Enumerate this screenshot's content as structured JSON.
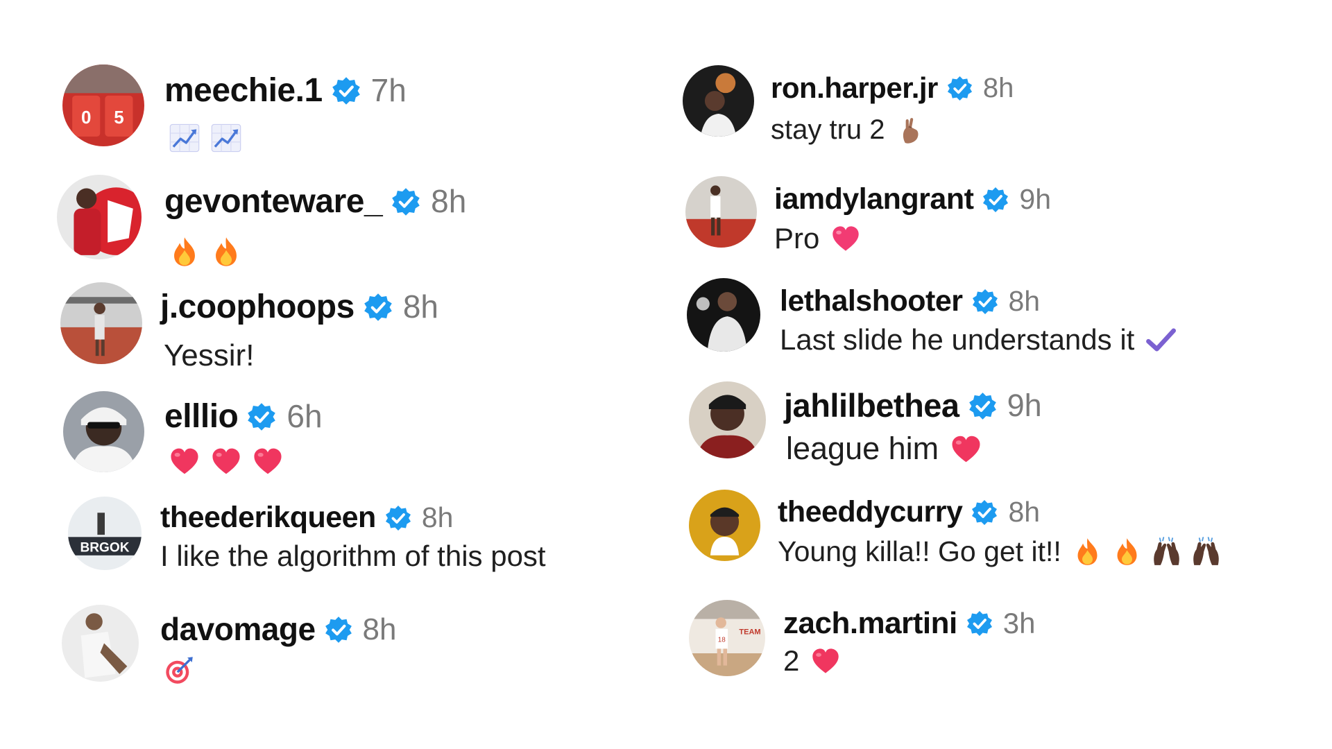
{
  "colors": {
    "verified": "#1d9bf0",
    "time": "#7a7a7a",
    "heart": "#f0365f",
    "fire": "#ff7b1c"
  },
  "comments": [
    {
      "username": "meechie.1",
      "time": "7h",
      "text": "",
      "emojis": [
        "chart-increasing",
        "chart-increasing"
      ]
    },
    {
      "username": "gevonteware_",
      "time": "8h",
      "text": "",
      "emojis": [
        "fire",
        "fire"
      ]
    },
    {
      "username": "j.coophoops",
      "time": "8h",
      "text": "Yessir!",
      "emojis": []
    },
    {
      "username": "elllio",
      "time": "6h",
      "text": "",
      "emojis": [
        "red-heart",
        "red-heart",
        "red-heart"
      ]
    },
    {
      "username": "theederikqueen",
      "time": "8h",
      "text": "I like the algorithm of this post",
      "emojis": []
    },
    {
      "username": "davomage",
      "time": "8h",
      "text": "",
      "emojis": [
        "bullseye"
      ]
    },
    {
      "username": "ron.harper.jr",
      "time": "8h",
      "text": "stay tru 2",
      "emojis": [
        "crossed-fingers"
      ]
    },
    {
      "username": "iamdylangrant",
      "time": "9h",
      "text": "Pro",
      "emojis": [
        "pink-heart"
      ]
    },
    {
      "username": "lethalshooter",
      "time": "8h",
      "text": "Last slide he understands it",
      "emojis": [
        "check-mark"
      ]
    },
    {
      "username": "jahlilbethea",
      "time": "9h",
      "text": "league him",
      "emojis": [
        "red-heart"
      ]
    },
    {
      "username": "theeddycurry",
      "time": "8h",
      "text": "Young killa!! Go get it!!",
      "emojis": [
        "fire",
        "fire",
        "raising-hands",
        "raising-hands"
      ]
    },
    {
      "username": "zach.martini",
      "time": "3h",
      "text": "2",
      "emojis": [
        "red-heart"
      ]
    }
  ]
}
